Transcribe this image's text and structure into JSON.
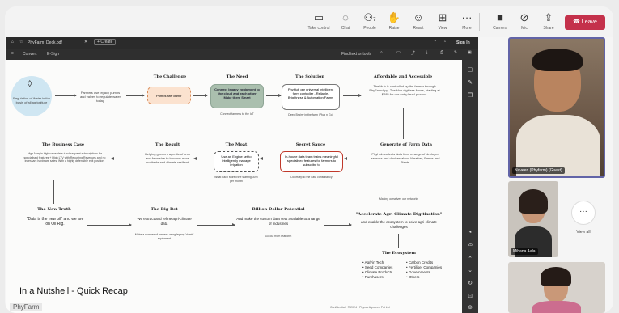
{
  "toolbar": {
    "items": [
      {
        "label": "Take control",
        "icon": "take-control-icon",
        "glyph": "▭"
      },
      {
        "label": "Chat",
        "icon": "chat-icon",
        "glyph": "☺"
      },
      {
        "label": "People",
        "icon": "people-icon",
        "glyph": "⚇",
        "count": "7"
      },
      {
        "label": "Raise",
        "icon": "raise-hand-icon",
        "glyph": "✋"
      },
      {
        "label": "React",
        "icon": "react-icon",
        "glyph": "☺"
      },
      {
        "label": "View",
        "icon": "view-icon",
        "glyph": "⊞"
      },
      {
        "label": "More",
        "icon": "more-icon",
        "glyph": "···"
      },
      {
        "label": "Camera",
        "icon": "camera-icon",
        "glyph": "■"
      },
      {
        "label": "Mic",
        "icon": "mic-off-icon",
        "glyph": "♪"
      },
      {
        "label": "Share",
        "icon": "share-icon",
        "glyph": "▲"
      }
    ],
    "leave_label": "Leave",
    "leave_color": "#c4314b"
  },
  "viewer": {
    "tab_name": "PhyFarm_Deck.pdf",
    "new_tab": "Create",
    "sign_in": "Sign In",
    "menu_left": [
      "Convert",
      "E-Sign"
    ],
    "find_text": "Find text or tools"
  },
  "slide": {
    "title": "In a Nutshell - Quick Recap",
    "logo_text": "PhyFarm",
    "footer": "Confidential · © 2024 · Phyrus Agrotech Pvt Ltd",
    "regulation": "Regulation of Water is the basis of all agriculture",
    "intro_text": "Farmers use legacy pumps and valves to regulate water today",
    "challenge": {
      "heading": "The Challenge",
      "box": "Pumps are 'dumb'"
    },
    "need": {
      "heading": "The Need",
      "box": "Connect legacy equipment to the cloud and each other Make them Smart",
      "note": "Connect farmers to the IoT"
    },
    "solution": {
      "heading": "The Solution",
      "box": "PhyHub our universal intelligent farm controller - Reliable, Brightness & Automation Farms",
      "note": "Deep Brainy in the farm (Plug n Go)"
    },
    "affordable": {
      "heading": "Affordable and Accessible",
      "text": "The Hub is controlled by the farmer through PhyFarmApp. The Hub digitizes farms, starting at $285 for our entry level product."
    },
    "farm_data": {
      "heading": "Generate of Farm Data",
      "text": "PhyHub collects data from a range of deployed sensors and devices about Weather, Farms and Plants."
    },
    "secret": {
      "heading": "Secret Sauce",
      "box": "In-house data team trains meaningful specialised features for farmers to subscribe to",
      "note": "Doorstep to the data consultancy"
    },
    "moat": {
      "heading": "The Moat",
      "box": "Use an Engine set to intelligently manage irrigation",
      "note": "What each stored the starting 30% per month"
    },
    "result": {
      "heading": "The Result",
      "text": "Helping growers agentic of crop and farm size to become more profitable and climate resilient."
    },
    "business": {
      "heading": "The Business Case",
      "text": "High Margin high value data + subsequent subscriptions for specialised features + High LTV with Recurring Revenues and no incessant hardware sales. With a highly defensible exit position."
    },
    "truth": {
      "heading": "The New Truth",
      "text": "\"Data is the new oil\" and we are on Oil Rig."
    },
    "bet": {
      "heading": "The Big Bet",
      "text": "We extract and refine agri-climate data",
      "note": "Make a number of farmers using legacy 'dumb' equipment"
    },
    "billion": {
      "heading": "Billion Dollar Potential",
      "text": "And make the custom data sets available to a range of industries",
      "note": "Go out from Platform"
    },
    "accelerate": {
      "heading": "\"Accelerate Agri Climate Digitisation\"",
      "text": "and enable the ecosystem to solve agri-climate challenges",
      "note": "Making ourselves our networks"
    },
    "ecosystem": {
      "heading": "The Ecosystem",
      "col1": [
        "Ag/Fin Tech",
        "Seed Companies",
        "Climate Products",
        "Purchasers"
      ],
      "col2": [
        "Carbon Credits",
        "Fertiliser Companies",
        "Governments",
        "Others"
      ]
    }
  },
  "participants": [
    {
      "name": "Naveen (Phyfarm) (Guest)"
    },
    {
      "name": "Mihana Aala"
    },
    {
      "name": "View all"
    },
    {
      "name": ""
    }
  ]
}
